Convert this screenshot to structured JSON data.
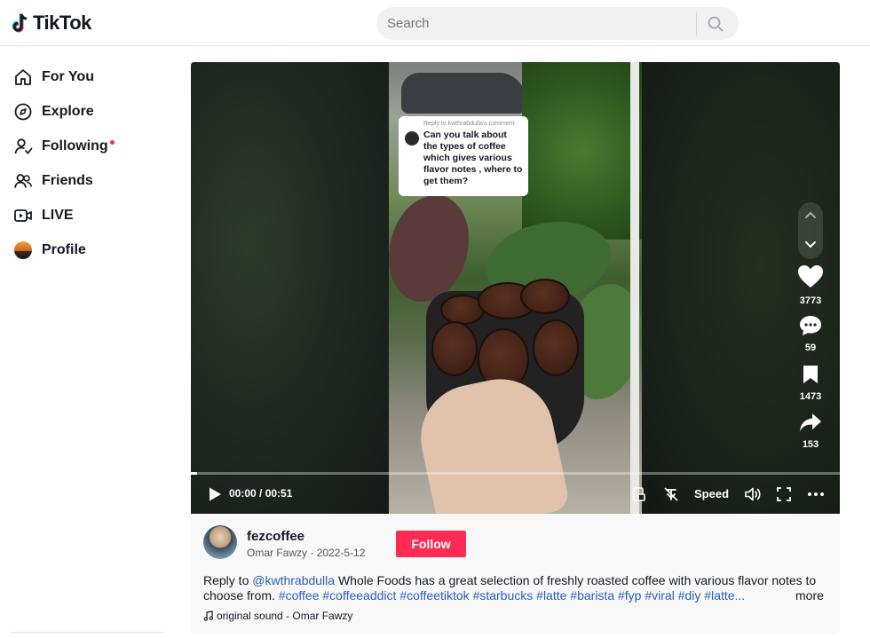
{
  "app": {
    "name": "TikTok"
  },
  "search": {
    "placeholder": "Search"
  },
  "sidebar": {
    "items": [
      {
        "label": "For You",
        "icon": "home-icon"
      },
      {
        "label": "Explore",
        "icon": "compass-icon"
      },
      {
        "label": "Following",
        "icon": "following-icon",
        "has_dot": true
      },
      {
        "label": "Friends",
        "icon": "friends-icon"
      },
      {
        "label": "LIVE",
        "icon": "live-icon"
      },
      {
        "label": "Profile",
        "icon": "profile-avatar"
      }
    ]
  },
  "video": {
    "reply_bubble": {
      "header": "Reply to kwthrabdulla's comment",
      "text": "Can you talk about the types of coffee which gives various flavor notes , where to get them?"
    },
    "actions": {
      "likes": "3773",
      "comments": "59",
      "saves": "1473",
      "shares": "153"
    },
    "controls": {
      "time": "00:00 / 00:51",
      "speed_label": "Speed",
      "progress": 0.01
    }
  },
  "post": {
    "username": "fezcoffee",
    "display_name": "Omar Fawzy",
    "date": "2022-5-12",
    "meta_separator": " · ",
    "follow_label": "Follow",
    "description": {
      "prefix": "Reply to ",
      "mention": "@kwthrabdulla",
      "text": " Whole Foods has a great selection of freshly roasted coffee with various flavor notes to choose from. ",
      "hashtags": [
        "#coffee",
        "#coffeeaddict",
        "#coffeetiktok",
        "#starbucks",
        "#latte",
        "#barista",
        "#fyp",
        "#viral",
        "#diy",
        "#latte..."
      ]
    },
    "more_label": "more",
    "sound": "original sound - Omar Fawzy"
  },
  "colors": {
    "accent": "#fe2c55",
    "link": "#2b5db9",
    "text": "#161823"
  }
}
